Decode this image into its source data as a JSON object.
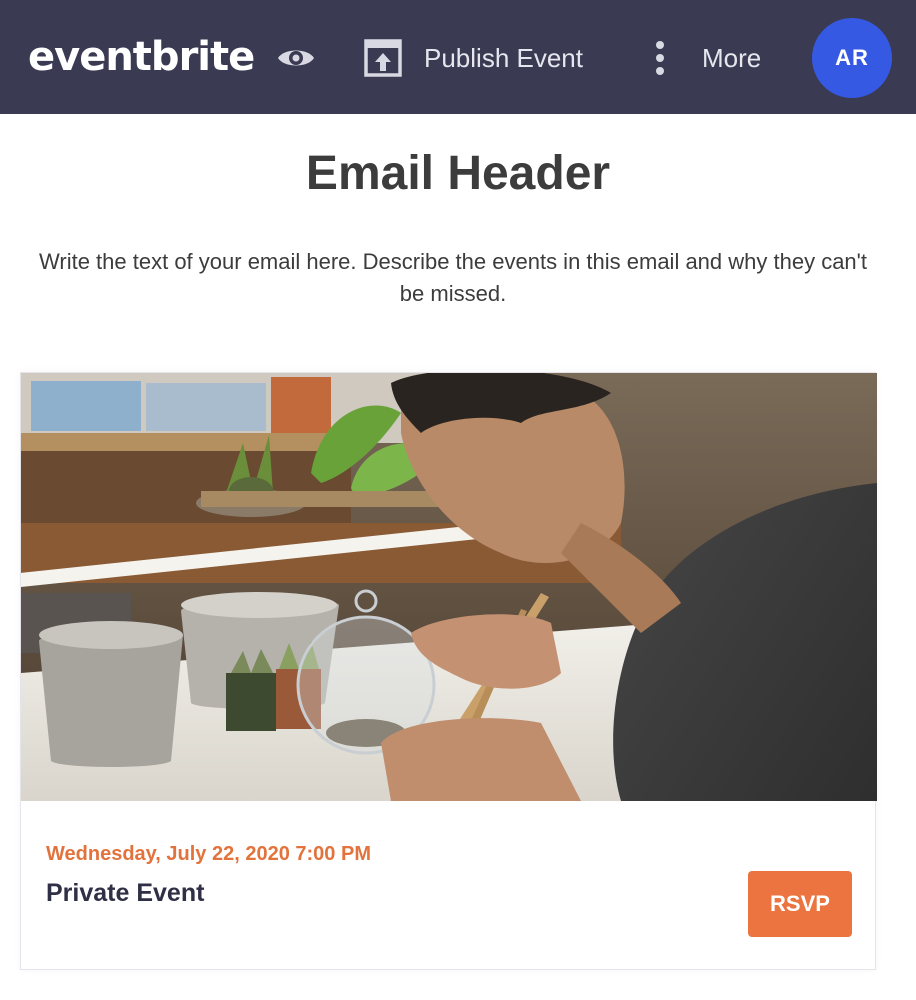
{
  "topbar": {
    "logo": "eventbrite",
    "preview_icon": "eye-icon",
    "publish_icon": "publish-upload-icon",
    "publish_label": "Publish Event",
    "more_icon": "vertical-dots-icon",
    "more_label": "More",
    "avatar_initials": "AR",
    "bg_color": "#3a3a52",
    "avatar_color": "#3659e3"
  },
  "email": {
    "title": "Email Header",
    "body": "Write the text of your email here. Describe the events in this email and why they can't be missed."
  },
  "event_card": {
    "date": "Wednesday, July 22, 2020 7:00 PM",
    "name": "Private Event",
    "rsvp_label": "RSVP",
    "accent_color": "#eb7440"
  }
}
